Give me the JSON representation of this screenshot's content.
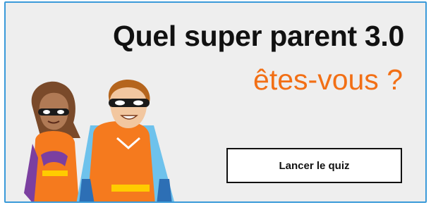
{
  "banner": {
    "title": "Quel super parent 3.0",
    "subtitle": "êtes-vous ?",
    "cta_label": "Lancer le quiz"
  },
  "colors": {
    "accent": "#f26f15",
    "border": "#3a9ad9",
    "background": "#eeeeee",
    "text": "#111111"
  },
  "illustration": {
    "icon": "superhero-parents-illustration"
  }
}
